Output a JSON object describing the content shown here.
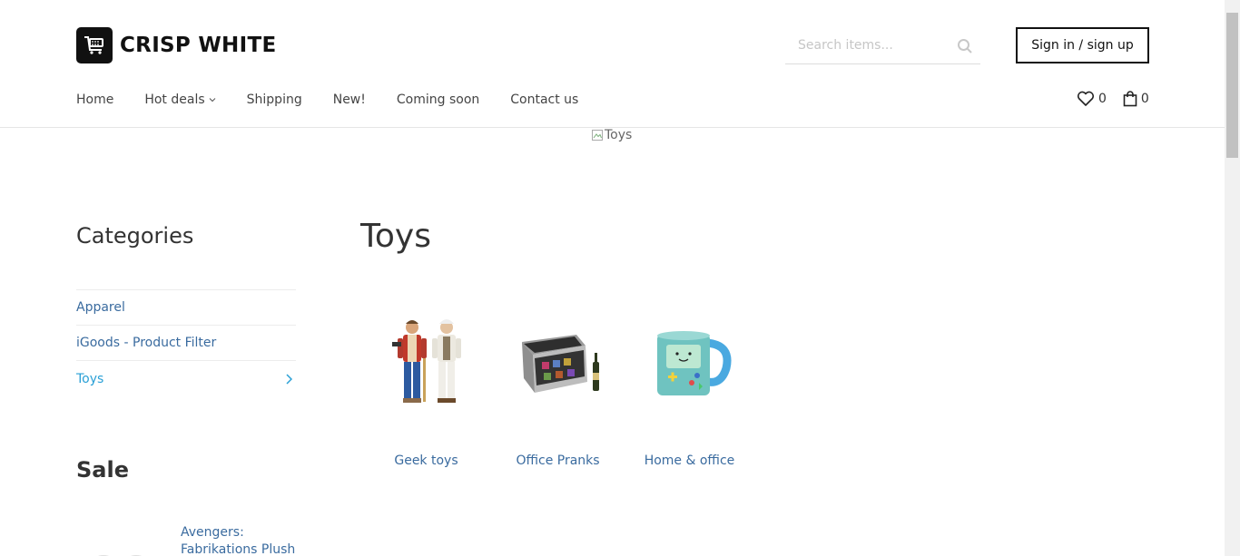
{
  "brand": {
    "name": "CRISP WHITE",
    "icon": "cart-logo-icon"
  },
  "search": {
    "placeholder": "Search items..."
  },
  "signin": {
    "label": "Sign in / sign up"
  },
  "nav": {
    "items": [
      {
        "label": "Home"
      },
      {
        "label": "Hot deals",
        "has_dropdown": true
      },
      {
        "label": "Shipping"
      },
      {
        "label": "New!"
      },
      {
        "label": "Coming soon"
      },
      {
        "label": "Contact us"
      }
    ]
  },
  "counters": {
    "wishlist": "0",
    "cart": "0"
  },
  "banner": {
    "alt": "Toys"
  },
  "sidebar": {
    "title": "Categories",
    "items": [
      {
        "label": "Apparel"
      },
      {
        "label": "iGoods - Product Filter"
      },
      {
        "label": "Toys",
        "active": true
      }
    ]
  },
  "sale": {
    "title": "Sale",
    "product_name": "Avengers: Fabrikations Plush"
  },
  "main": {
    "title": "Toys",
    "subcategories": [
      {
        "label": "Geek toys",
        "image": "action-figures"
      },
      {
        "label": "Office Pranks",
        "image": "briefcase-with-bottle"
      },
      {
        "label": "Home & office",
        "image": "bmo-mug"
      }
    ]
  },
  "colors": {
    "link": "#3a6b9f",
    "active": "#2aa0d6",
    "text": "#333333"
  }
}
